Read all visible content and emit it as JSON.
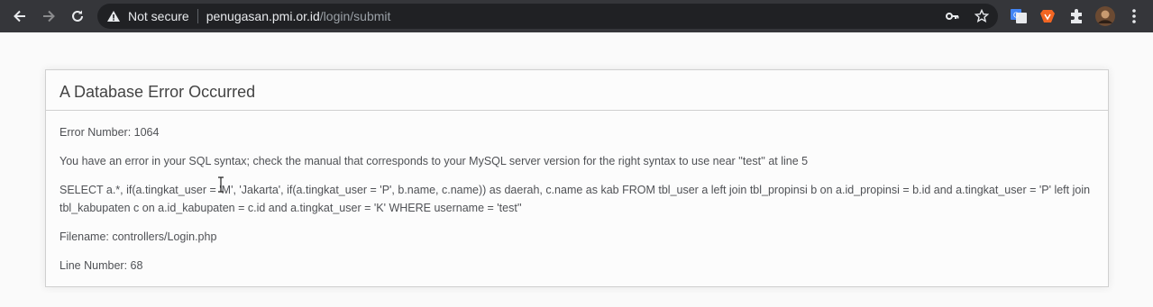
{
  "browser": {
    "security_label": "Not secure",
    "url_host": "penugasan.pmi.or.id",
    "url_path": "/login/submit"
  },
  "error": {
    "heading": "A Database Error Occurred",
    "error_number": "Error Number: 1064",
    "message": "You have an error in your SQL syntax; check the manual that corresponds to your MySQL server version for the right syntax to use near ''test'' at line 5",
    "query": "SELECT a.*, if(a.tingkat_user = 'M', 'Jakarta', if(a.tingkat_user = 'P', b.name, c.name)) as daerah, c.name as kab FROM tbl_user a left join tbl_propinsi b on a.id_propinsi = b.id and a.tingkat_user = 'P' left join tbl_kabupaten c on a.id_kabupaten = c.id and a.tingkat_user = 'K' WHERE username = 'test''",
    "filename": "Filename: controllers/Login.php",
    "line_number": "Line Number: 68"
  },
  "colors": {
    "toolbar": "#35363a",
    "omnibox": "#202124",
    "brave_ext": "#f26522",
    "translate_ext": "#4285f4"
  }
}
